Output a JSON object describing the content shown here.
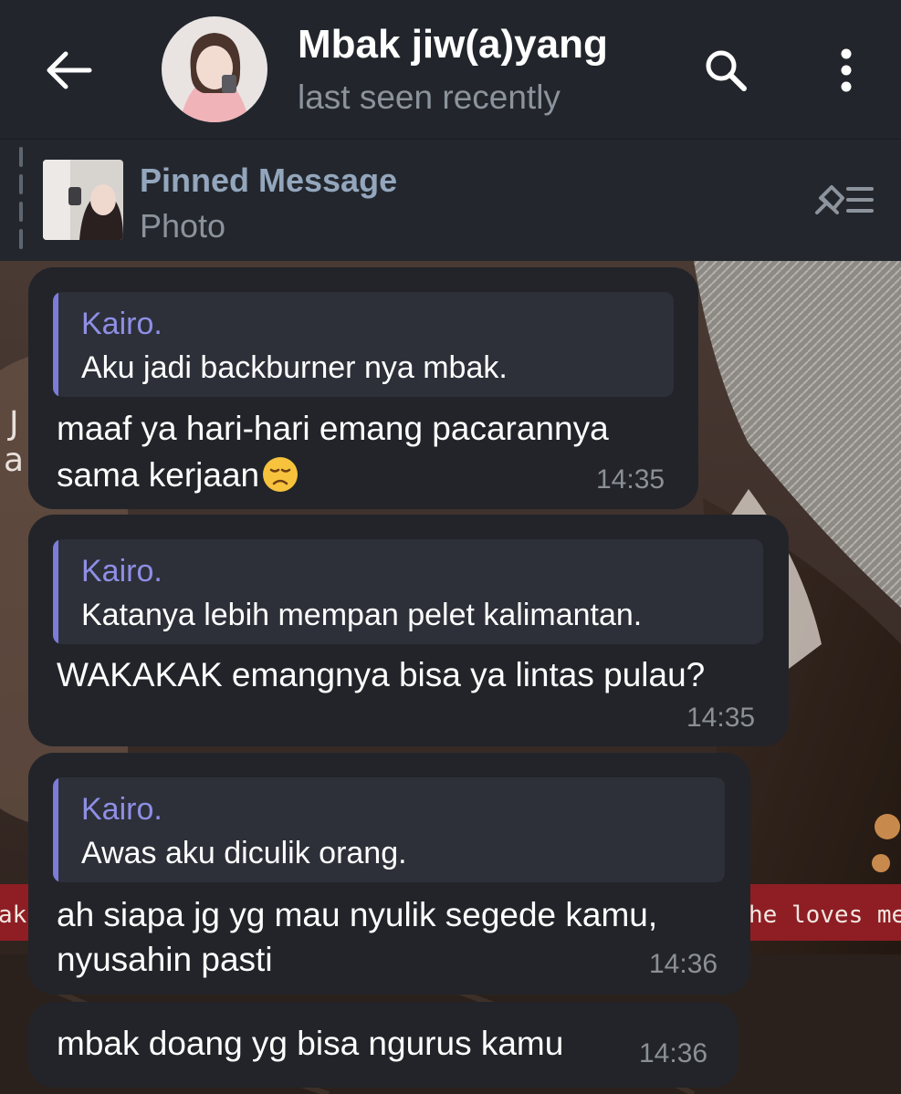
{
  "header": {
    "title": "Mbak jiw(a)yang",
    "status": "last seen recently",
    "icons": [
      "back-arrow-icon",
      "search-icon",
      "more-vertical-icon"
    ]
  },
  "pinned": {
    "title": "Pinned Message",
    "subtitle": "Photo",
    "icons": [
      "pin-list-icon"
    ]
  },
  "messages": [
    {
      "reply_name": "Kairo.",
      "reply_text": "Aku jadi backburner nya mbak.",
      "text_lines": [
        "maaf ya hari-hari emang pacarannya",
        "sama kerjaan"
      ],
      "emoji": "disappointed-face-emoji",
      "time": "14:35"
    },
    {
      "reply_name": "Kairo.",
      "reply_text": "Katanya lebih mempan pelet kalimantan.",
      "text_lines": [
        "WAKAKAK emangnya bisa ya lintas pulau?"
      ],
      "time": "14:35"
    },
    {
      "reply_name": "Kairo.",
      "reply_text": "Awas aku diculik orang.",
      "text_lines": [
        "ah siapa jg yg mau nyulik segede kamu,",
        "nyusahin pasti"
      ],
      "time": "14:36"
    },
    {
      "text_lines": [
        "mbak doang yg bisa ngurus kamu"
      ],
      "time": "14:36"
    }
  ],
  "background": {
    "banner_left_text": "ak",
    "banner_right_text": "he loves me s"
  },
  "colors": {
    "header_bg": "#22262c",
    "bubble_bg": "#222429",
    "reply_bg": "#2d3039",
    "accent": "#7b7cd8",
    "pinned_title": "#93a6bd",
    "muted": "#8c939c"
  }
}
